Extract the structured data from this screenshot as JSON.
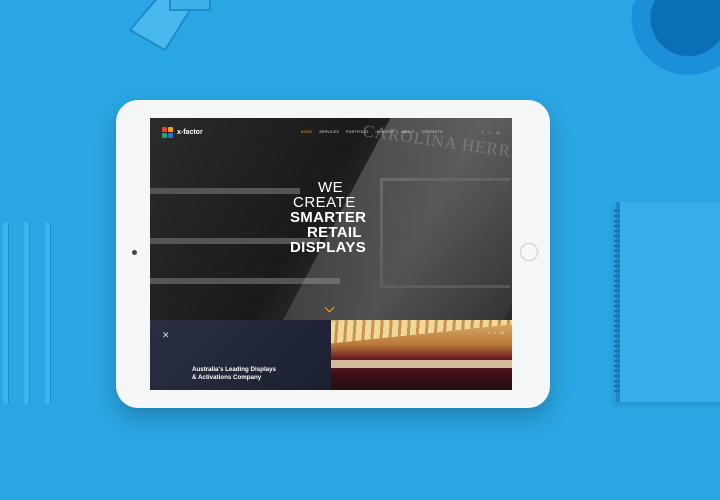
{
  "site": {
    "logo_text": "x-factor",
    "nav": [
      "HOME",
      "SERVICES",
      "PORTFOLIO",
      "INSIGHTS",
      "ABOUT",
      "CONTACTS"
    ],
    "social": [
      "f",
      "t",
      "◎"
    ],
    "store_sign": "CAROLINA HERRERA",
    "headline": [
      "WE",
      "CREATE",
      "SMARTER",
      "RETAIL",
      "DISPLAYS"
    ],
    "tagline_line1": "Australia's Leading Displays",
    "tagline_line2": "& Activations Company",
    "section_icon": "✕"
  },
  "colors": {
    "background": "#2aa6e4",
    "accent": "#f6a21e"
  },
  "icons": {
    "logo": "x-factor-logo-icon",
    "scroll": "chevron-down-icon",
    "facebook": "facebook-icon",
    "twitter": "twitter-icon",
    "instagram": "instagram-icon"
  }
}
